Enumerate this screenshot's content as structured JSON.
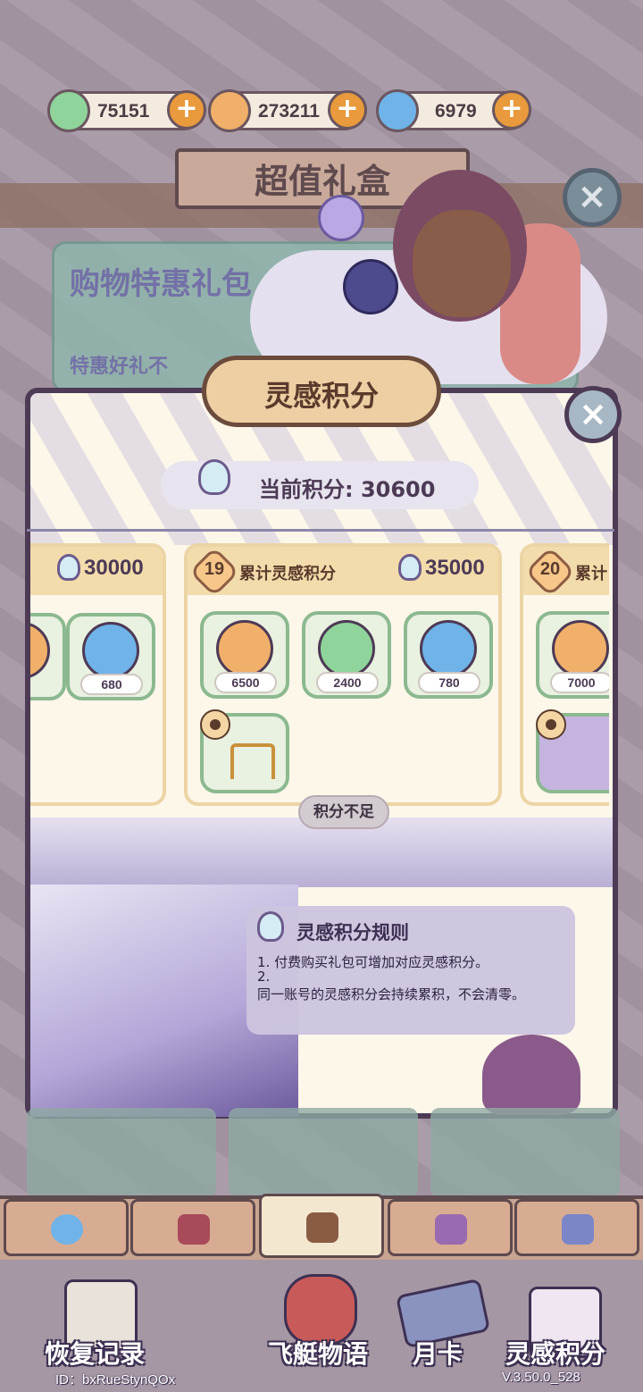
{
  "currencies": [
    {
      "icon": "clover-gem-icon",
      "value": "75151",
      "color": "#8fd49a"
    },
    {
      "icon": "leaf-coin-icon",
      "value": "273211",
      "color": "#f0b06a"
    },
    {
      "icon": "spiral-gem-icon",
      "value": "6979",
      "color": "#6fb3e8"
    }
  ],
  "background_window": {
    "title": "超值礼盒",
    "panel_title": "购物特惠礼包",
    "panel_subtitle": "特惠好礼不"
  },
  "modal": {
    "title": "灵感积分",
    "current_score_label": "当前积分: 30600",
    "not_enough_label": "积分不足"
  },
  "cards": [
    {
      "level": "",
      "label": "",
      "requirement": "30000",
      "items": [
        {
          "icon": "spiral-gem-icon",
          "qty": "680"
        }
      ]
    },
    {
      "level": "19",
      "label": "累计灵感积分",
      "requirement": "35000",
      "items": [
        {
          "icon": "leaf-coin-icon",
          "qty": "6500"
        },
        {
          "icon": "clover-gem-icon",
          "qty": "2400"
        },
        {
          "icon": "spiral-gem-icon",
          "qty": "780"
        }
      ]
    },
    {
      "level": "20",
      "label": "累计",
      "requirement": "",
      "items": [
        {
          "icon": "leaf-coin-icon",
          "qty": "7000"
        }
      ]
    }
  ],
  "rules": {
    "title": "灵感积分规则",
    "line1": "1. 付费购买礼包可增加对应灵感积分。",
    "line2": "2.",
    "line3": "同一账号的灵感积分会持续累积，不会清零。"
  },
  "bottom_nav": [
    {
      "label": "恢复记录",
      "icon": "clipboard-icon"
    },
    {
      "label": "飞艇物语",
      "icon": "airship-story-icon"
    },
    {
      "label": "月卡",
      "icon": "monthly-card-icon"
    },
    {
      "label": "灵感积分",
      "icon": "inspiration-points-icon"
    }
  ],
  "footer": {
    "user_id": "ID：bxRueStynQOx",
    "version": "V.3.50.0_528"
  },
  "colors": {
    "accent": "#e89a3c",
    "modal_border": "#4d3a55",
    "card_header": "#f3dcab"
  }
}
